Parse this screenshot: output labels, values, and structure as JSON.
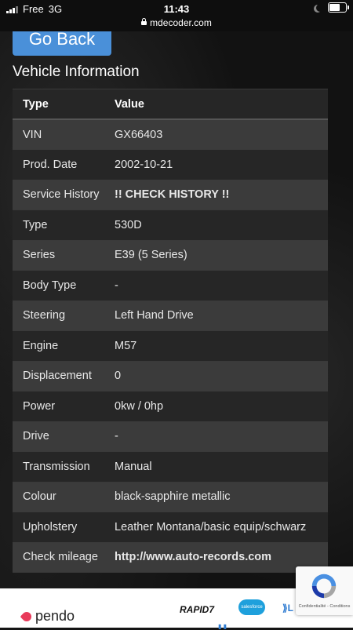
{
  "status_bar": {
    "carrier": "Free",
    "network": "3G",
    "time": "11:43"
  },
  "browser": {
    "url": "mdecoder.com"
  },
  "nav": {
    "go_back_label": "Go Back"
  },
  "section_title": "Vehicle Information",
  "table": {
    "headers": [
      "Type",
      "Value"
    ],
    "rows": [
      {
        "type": "VIN",
        "value": "GX66403"
      },
      {
        "type": "Prod. Date",
        "value": "2002-10-21"
      },
      {
        "type": "Service History",
        "value": "!! CHECK HISTORY !!"
      },
      {
        "type": "Type",
        "value": "530D"
      },
      {
        "type": "Series",
        "value": "E39 (5 Series)"
      },
      {
        "type": "Body Type",
        "value": "-"
      },
      {
        "type": "Steering",
        "value": "Left Hand Drive"
      },
      {
        "type": "Engine",
        "value": "M57"
      },
      {
        "type": "Displacement",
        "value": "0"
      },
      {
        "type": "Power",
        "value": "0kw / 0hp"
      },
      {
        "type": "Drive",
        "value": "-"
      },
      {
        "type": "Transmission",
        "value": "Manual"
      },
      {
        "type": "Colour",
        "value": "black-sapphire metallic"
      },
      {
        "type": "Upholstery",
        "value": "Leather Montana/basic equip/schwarz"
      },
      {
        "type": "Check mileage",
        "value": "http://www.auto-records.com"
      }
    ]
  },
  "footer": {
    "logos": [
      "pendo",
      "RAPID7",
      "salesforce"
    ]
  },
  "recaptcha": {
    "text": "Confidentialité - Conditions"
  },
  "colors": {
    "warning": "#e0322a",
    "link": "#4aa3d4",
    "button": "#4a90d9"
  }
}
